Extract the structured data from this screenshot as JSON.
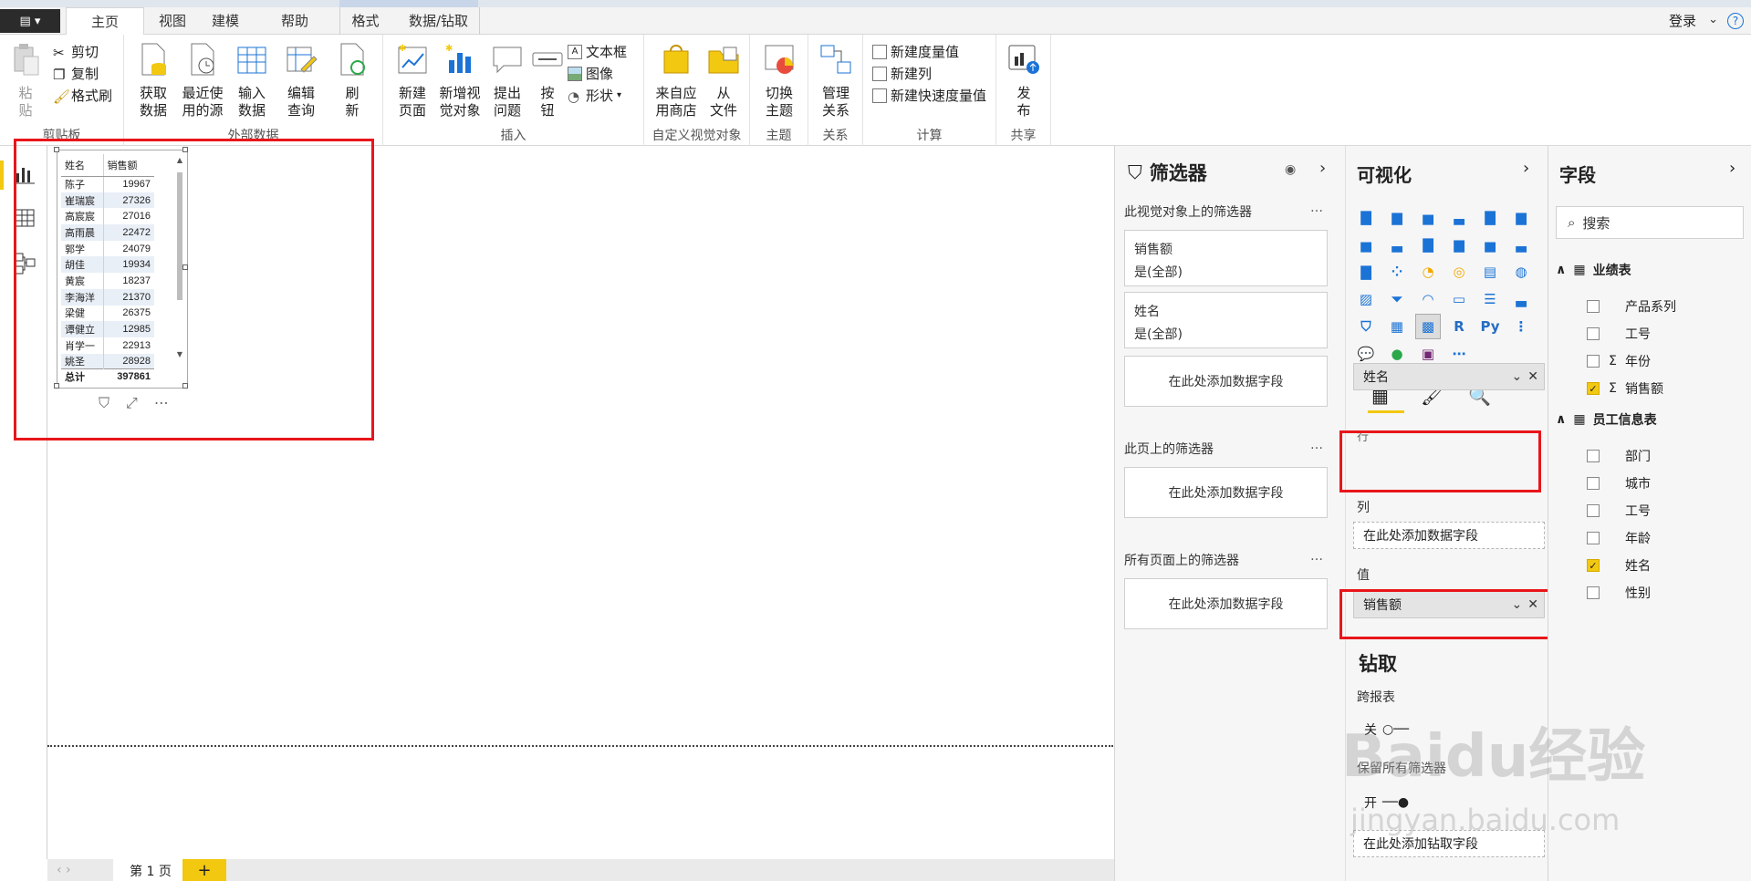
{
  "tabs": [
    "主页",
    "视图",
    "建模",
    "帮助",
    "格式",
    "数据/钻取"
  ],
  "login": "登录",
  "ribbon": {
    "clipboard": {
      "label": "剪贴板",
      "paste": "粘\n贴",
      "cut": "剪切",
      "copy": "复制",
      "format_painter": "格式刷"
    },
    "external": {
      "label": "外部数据",
      "get_data": "获取\n数据",
      "recent": "最近使\n用的源",
      "enter": "输入\n数据",
      "edit": "编辑\n查询",
      "refresh": "刷\n新"
    },
    "insert": {
      "label": "插入",
      "new_page": "新建\n页面",
      "new_visual": "新增视\n觉对象",
      "ask": "提出\n问题",
      "buttons": "按\n钮",
      "textbox": "文本框",
      "image": "图像",
      "shapes": "形状"
    },
    "custom": {
      "label": "自定义视觉对象",
      "marketplace": "来自应\n用商店",
      "from_file": "从\n文件"
    },
    "themes": {
      "label": "主题",
      "switch": "切换\n主题"
    },
    "relations": {
      "label": "关系",
      "manage": "管理\n关系"
    },
    "calc": {
      "label": "计算",
      "new_measure": "新建度量值",
      "new_column": "新建列",
      "quick_measure": "新建快速度量值"
    },
    "share": {
      "label": "共享",
      "publish": "发\n布"
    }
  },
  "table": {
    "headers": [
      "姓名",
      "销售额"
    ],
    "rows": [
      [
        "陈子",
        "19967"
      ],
      [
        "崔瑞宸",
        "27326"
      ],
      [
        "高宸宸",
        "27016"
      ],
      [
        "高雨晨",
        "22472"
      ],
      [
        "郭学",
        "24079"
      ],
      [
        "胡佳",
        "19934"
      ],
      [
        "黄宸",
        "18237"
      ],
      [
        "李海洋",
        "21370"
      ],
      [
        "梁健",
        "26375"
      ],
      [
        "谭健立",
        "12985"
      ],
      [
        "肖学一",
        "22913"
      ],
      [
        "姚圣",
        "28928"
      ]
    ],
    "total_label": "总计",
    "total_value": "397861"
  },
  "filters": {
    "title": "筛选器",
    "visual_section": "此视觉对象上的筛选器",
    "cards": [
      {
        "field": "销售额",
        "state": "是(全部)"
      },
      {
        "field": "姓名",
        "state": "是(全部)"
      }
    ],
    "add_field": "在此处添加数据字段",
    "page_section": "此页上的筛选器",
    "all_pages_section": "所有页面上的筛选器",
    "more": "…"
  },
  "viz": {
    "title": "可视化",
    "rows_label": "行",
    "rows_field": "姓名",
    "columns_label": "列",
    "columns_placeholder": "在此处添加数据字段",
    "values_label": "值",
    "values_field": "销售额",
    "drill_title": "钻取",
    "cross_report": "跨报表",
    "off": "关",
    "keep_filters": "保留所有筛选器",
    "on": "开",
    "drill_placeholder": "在此处添加钻取字段"
  },
  "fields": {
    "title": "字段",
    "search_placeholder": "搜索",
    "tables": [
      {
        "name": "业绩表",
        "fields": [
          {
            "name": "产品系列",
            "checked": false,
            "sigma": false
          },
          {
            "name": "工号",
            "checked": false,
            "sigma": false
          },
          {
            "name": "年份",
            "checked": false,
            "sigma": true
          },
          {
            "name": "销售额",
            "checked": true,
            "sigma": true
          }
        ]
      },
      {
        "name": "员工信息表",
        "fields": [
          {
            "name": "部门",
            "checked": false,
            "sigma": false
          },
          {
            "name": "城市",
            "checked": false,
            "sigma": false
          },
          {
            "name": "工号",
            "checked": false,
            "sigma": false
          },
          {
            "name": "年龄",
            "checked": false,
            "sigma": false
          },
          {
            "name": "姓名",
            "checked": true,
            "sigma": false
          },
          {
            "name": "性别",
            "checked": false,
            "sigma": false
          }
        ]
      }
    ]
  },
  "page_tab": "第 1 页",
  "add_page": "+",
  "watermark": {
    "brand": "Baidu经验",
    "url": "jingyan.baidu.com"
  },
  "colors": {
    "accent": "#f2c811",
    "highlight": "#e8161b",
    "link_blue": "#1b73d6"
  }
}
